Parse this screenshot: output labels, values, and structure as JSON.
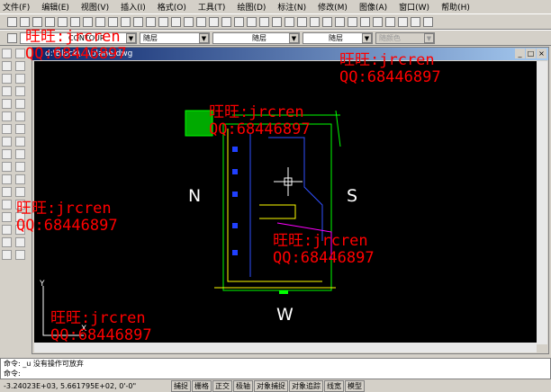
{
  "menu": [
    "文件(F)",
    "编辑(E)",
    "视图(V)",
    "插入(I)",
    "格式(O)",
    "工具(T)",
    "绘图(D)",
    "标注(N)",
    "修改(M)",
    "图像(A)",
    "窗口(W)",
    "帮助(H)"
  ],
  "layerbar": {
    "layer": "CONTOUR",
    "color": "随层",
    "linetype": "随层",
    "lineweight": "随层",
    "plotstyle": "随颜色"
  },
  "window": {
    "title": "d:\\Block\\...\\plane.dwg"
  },
  "drawing": {
    "labels": {
      "n": "N",
      "s": "S",
      "w": "W"
    },
    "colors": {
      "green": "#00ff00",
      "yellow": "#ffff00",
      "blue": "#0000ff",
      "magenta": "#ff00ff"
    }
  },
  "watermarks": [
    {
      "l1": "旺旺:jrcren",
      "l2": "QQ:68446897"
    }
  ],
  "command": {
    "line1": "命令: _u 没有操作可放弃",
    "line2": "命令:"
  },
  "status": {
    "coords": "-3.24023E+03, 5.661795E+02, 0'-0\"",
    "buttons": [
      "捕捉",
      "栅格",
      "正交",
      "极轴",
      "对象捕捉",
      "对象追踪",
      "线宽",
      "模型"
    ]
  }
}
